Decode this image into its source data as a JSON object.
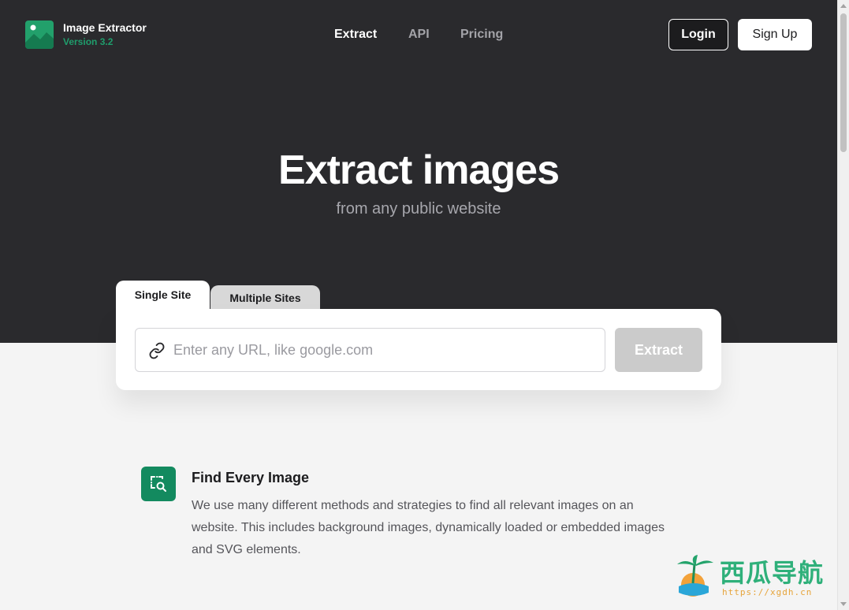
{
  "header": {
    "brand_name": "Image Extractor",
    "brand_version": "Version 3.2",
    "nav": [
      {
        "label": "Extract",
        "active": true
      },
      {
        "label": "API",
        "active": false
      },
      {
        "label": "Pricing",
        "active": false
      }
    ],
    "login_label": "Login",
    "signup_label": "Sign Up"
  },
  "hero": {
    "title": "Extract images",
    "subtitle": "from any public website"
  },
  "extractor": {
    "tabs": [
      {
        "label": "Single Site",
        "active": true
      },
      {
        "label": "Multiple Sites",
        "active": false
      }
    ],
    "url_value": "",
    "url_placeholder": "Enter any URL, like google.com",
    "extract_label": "Extract"
  },
  "features": [
    {
      "icon": "image-search-icon",
      "title": "Find Every Image",
      "description": "We use many different methods and strategies to find all relevant images on an website. This includes background images, dynamically loaded or embedded images and SVG elements."
    }
  ],
  "watermark": {
    "title": "西瓜导航",
    "url": "https://xgdh.cn"
  },
  "colors": {
    "hero_bg": "#2a2a2d",
    "brand_green": "#1f9d6c",
    "feature_icon_bg": "#138a5f",
    "extract_disabled": "#cbcbcb"
  }
}
